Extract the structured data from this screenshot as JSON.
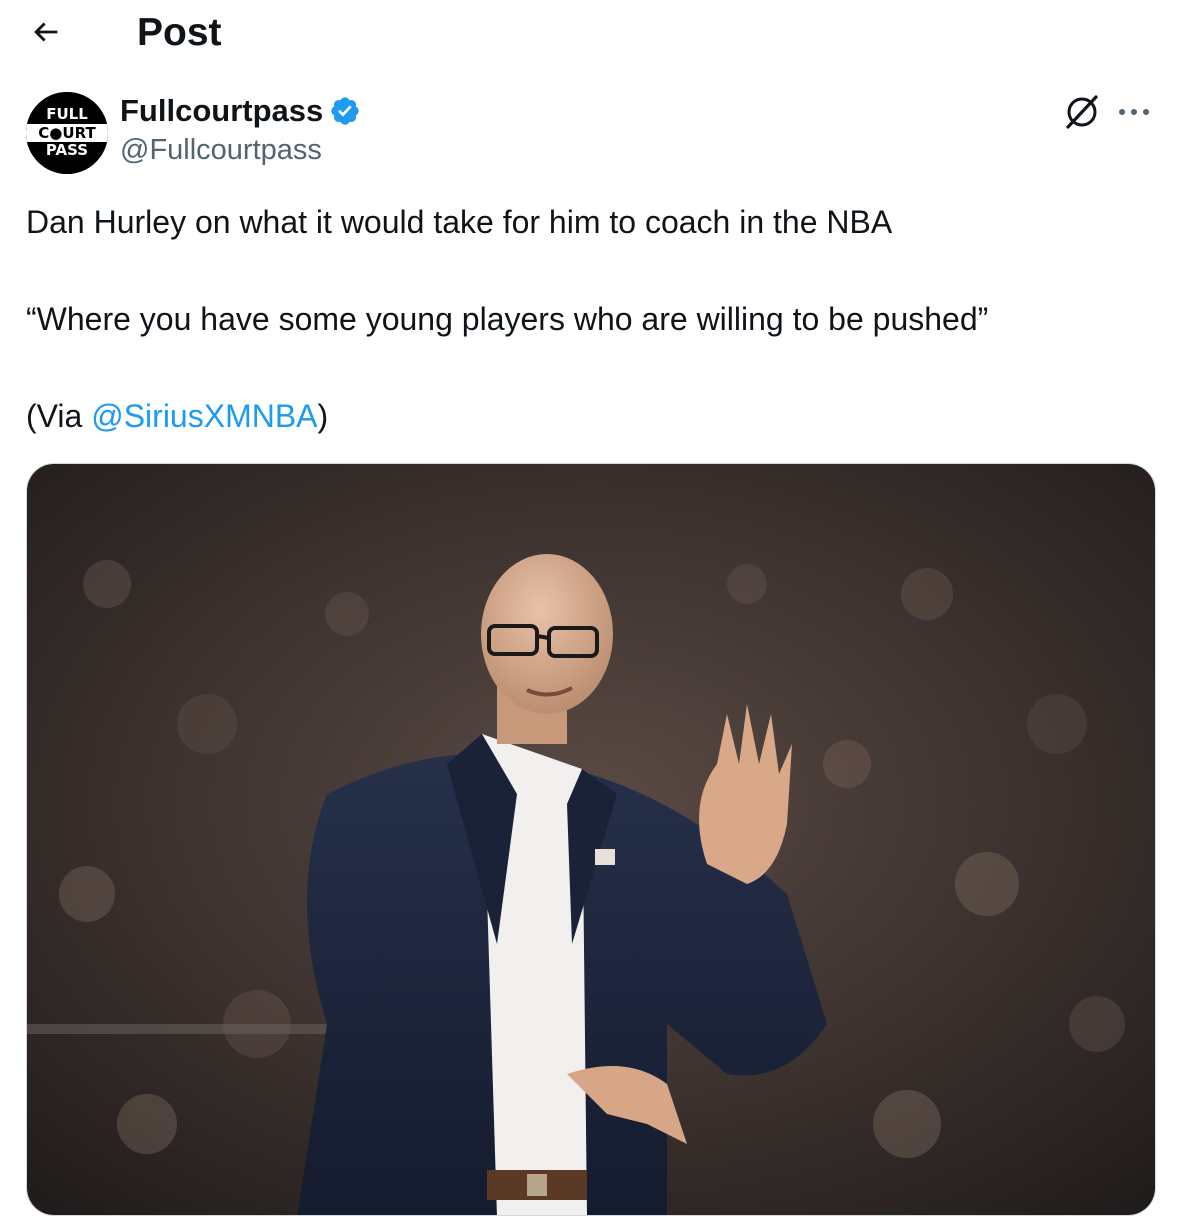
{
  "header": {
    "title": "Post",
    "back_icon": "arrow-left-icon"
  },
  "author": {
    "display_name": "Fullcourtpass",
    "handle": "@Fullcourtpass",
    "verified": true,
    "verified_color": "#1d9bf0",
    "avatar_text": [
      "FULL",
      "C●URT",
      "PASS"
    ]
  },
  "actions": {
    "grok_icon": "grok-icon",
    "more_icon": "more-dots-icon"
  },
  "tweet": {
    "line1": "Dan Hurley on what it would take for him to coach in the NBA",
    "line2": "“Where you have some young players who are willing to be pushed”",
    "line3_prefix": "(Via ",
    "line3_mention": "@SiriusXMNBA",
    "line3_suffix": ")"
  },
  "media": {
    "type": "photo",
    "subject": "coach in navy suit gesturing in arena"
  },
  "colors": {
    "text": "#0f1419",
    "secondary": "#536471",
    "link": "#1d9bf0"
  }
}
